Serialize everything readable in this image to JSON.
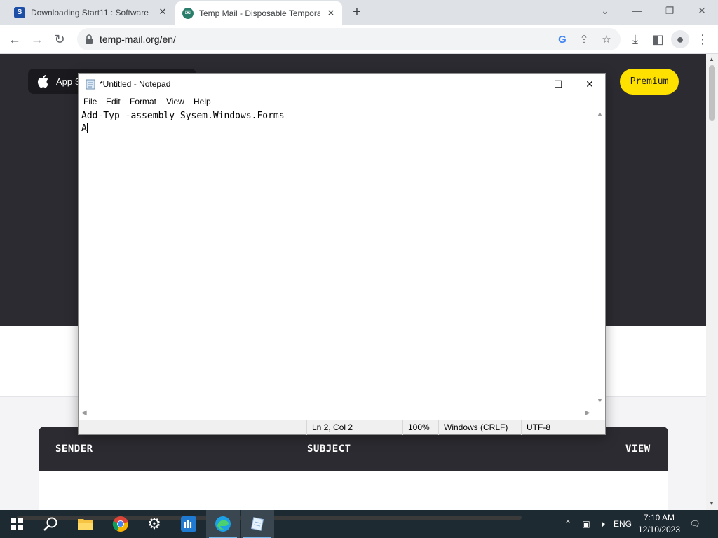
{
  "browser": {
    "tabs": [
      {
        "title": "Downloading Start11 : Software f",
        "favicon": "stardock-icon",
        "active": false
      },
      {
        "title": "Temp Mail - Disposable Tempora",
        "favicon": "temp-mail-icon",
        "active": true
      }
    ],
    "url": "temp-mail.org/en/"
  },
  "page": {
    "app_store_label": "App S",
    "premium_label": "Premium",
    "inbox_columns": {
      "sender": "SENDER",
      "subject": "SUBJECT",
      "view": "VIEW"
    }
  },
  "notepad": {
    "title": "*Untitled - Notepad",
    "menu": [
      "File",
      "Edit",
      "Format",
      "View",
      "Help"
    ],
    "lines": [
      "Add-Typ -assembly Sysem.Windows.Forms",
      "A"
    ],
    "status": {
      "position": "Ln 2, Col 2",
      "zoom": "100%",
      "line_ending": "Windows (CRLF)",
      "encoding": "UTF-8"
    }
  },
  "taskbar": {
    "apps": [
      "start-icon",
      "search-icon",
      "file-explorer-icon",
      "chrome-icon",
      "settings-icon",
      "start11-icon",
      "edge-icon",
      "notepad-icon"
    ],
    "language": "ENG",
    "time": "7:10 AM",
    "date": "12/10/2023"
  },
  "colors": {
    "premium": "#ffe100",
    "hero": "#2b2b31",
    "taskbar": "#1e2a32"
  }
}
